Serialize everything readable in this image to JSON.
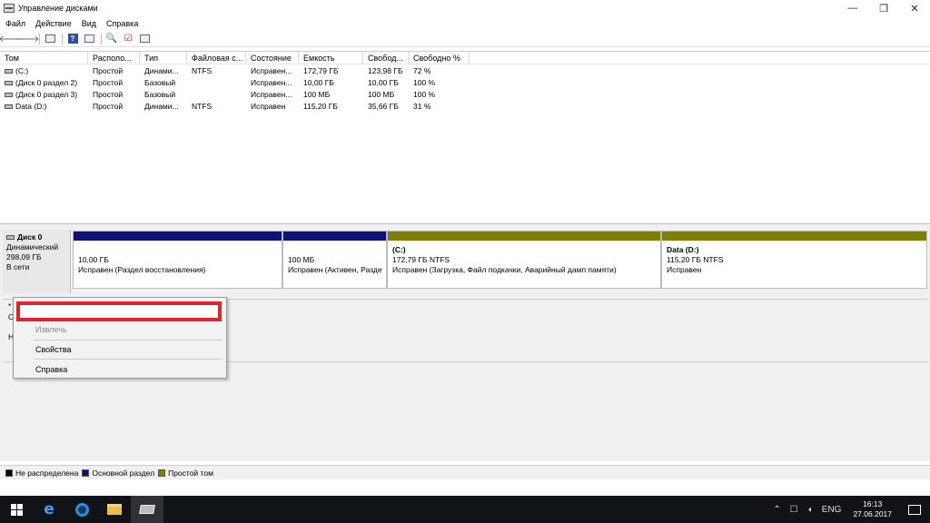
{
  "window": {
    "title": "Управление дисками",
    "minimize": "—",
    "restore": "❐",
    "close": "✕"
  },
  "menu": [
    "Файл",
    "Действие",
    "Вид",
    "Справка"
  ],
  "toolbar": {
    "back": "🡐",
    "forward": "🡒",
    "help": "?"
  },
  "volume_list": {
    "columns": [
      "Том",
      "Располо...",
      "Тип",
      "Файловая с...",
      "Состояние",
      "Емкость",
      "Свобод...",
      "Свободно %"
    ],
    "rows": [
      [
        "(C:)",
        "Простой",
        "Динами...",
        "NTFS",
        "Исправен...",
        "172,79 ГБ",
        "123,98 ГБ",
        "72 %"
      ],
      [
        "(Диск 0 раздел 2)",
        "Простой",
        "Базовый",
        "",
        "Исправен...",
        "10,00 ГБ",
        "10,00 ГБ",
        "100 %"
      ],
      [
        "(Диск 0 раздел 3)",
        "Простой",
        "Базовый",
        "",
        "Исправен...",
        "100 МБ",
        "100 МБ",
        "100 %"
      ],
      [
        "Data (D:)",
        "Простой",
        "Динами...",
        "NTFS",
        "Исправен",
        "115,20 ГБ",
        "35,66 ГБ",
        "31 %"
      ]
    ]
  },
  "disk0": {
    "name": "Диск 0",
    "type": "Динамический",
    "size": "298,09 ГБ",
    "status": "В сети"
  },
  "partitions": [
    {
      "title": "",
      "size": "10,00 ГБ",
      "status": "Исправен (Раздел восстановления)",
      "color": "#0a1478"
    },
    {
      "title": "",
      "size": "100 МБ",
      "status": "Исправен (Активен, Разде",
      "color": "#0a1478"
    },
    {
      "title": "(C:)",
      "size": "172,79 ГБ NTFS",
      "status": "Исправен (Загрузка, Файл подкачки, Аварийный дамп памяти)",
      "color": "#808000"
    },
    {
      "title": "Data  (D:)",
      "size": "115,20 ГБ NTFS",
      "status": "Исправен",
      "color": "#808000"
    }
  ],
  "cdrom_fragments": {
    "a": "*",
    "b": "C",
    "c": "H"
  },
  "context_menu": {
    "eject": "Извлечь",
    "properties": "Свойства",
    "help": "Справка"
  },
  "legend": [
    {
      "label": "Не распределена",
      "color": "#000000"
    },
    {
      "label": "Основной раздел",
      "color": "#0a1478"
    },
    {
      "label": "Простой том",
      "color": "#808000"
    }
  ],
  "taskbar": {
    "icons": [
      "windows-start-icon",
      "edge-icon",
      "app-circle-icon",
      "file-explorer-icon",
      "disk-management-icon"
    ],
    "language": "ENG",
    "time": "16:13",
    "date": "27.06.2017"
  }
}
